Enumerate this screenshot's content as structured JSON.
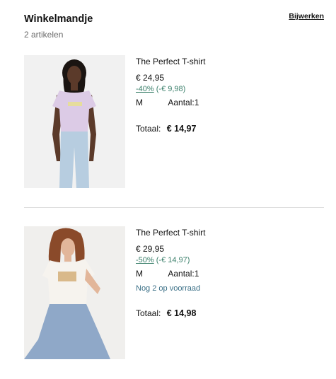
{
  "cart": {
    "title": "Winkelmandje",
    "count_label": "2 artikelen",
    "edit_label": "Bijwerken"
  },
  "items": [
    {
      "name": "The Perfect T-shirt",
      "price": "€ 24,95",
      "discount_pct": "-40%",
      "discount_amount": "(-€ 9,98)",
      "size": "M",
      "quantity": "Aantal:1",
      "total_label": "Totaal:",
      "total_value": "€ 14,97",
      "image_icon": "model-lilac-tshirt-photo"
    },
    {
      "name": "The Perfect T-shirt",
      "price": "€ 29,95",
      "discount_pct": "-50%",
      "discount_amount": "(-€ 14,97)",
      "size": "M",
      "quantity": "Aantal:1",
      "stock": "Nog 2 op voorraad",
      "total_label": "Totaal:",
      "total_value": "€ 14,98",
      "image_icon": "model-white-tshirt-photo"
    }
  ],
  "colors": {
    "discount": "#3a7f6a",
    "stock": "#3a6f86",
    "text": "#111111",
    "muted": "#6b6b6b"
  }
}
